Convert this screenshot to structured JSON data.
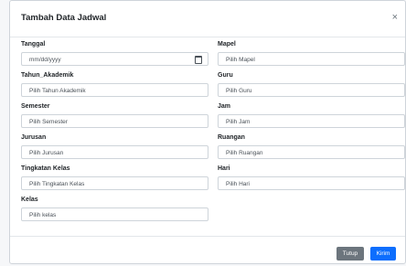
{
  "modal": {
    "title": "Tambah Data Jadwal",
    "close_glyph": "×"
  },
  "fields_left": [
    {
      "label": "Tanggal",
      "value": "mm/dd/yyyy"
    },
    {
      "label": "Tahun_Akademik",
      "value": "Pilih Tahun Akademik"
    },
    {
      "label": "Semester",
      "value": "Pilih Semester"
    },
    {
      "label": "Jurusan",
      "value": "Pilih Jurusan"
    },
    {
      "label": "Tingkatan Kelas",
      "value": "Pilih Tingkatan Kelas"
    },
    {
      "label": "Kelas",
      "value": "Pilih kelas"
    }
  ],
  "fields_right": [
    {
      "label": "Mapel",
      "value": "Pilih Mapel"
    },
    {
      "label": "Guru",
      "value": "Pilih Guru"
    },
    {
      "label": "Jam",
      "value": "Pilih Jam"
    },
    {
      "label": "Ruangan",
      "value": "Pilih Ruangan"
    },
    {
      "label": "Hari",
      "value": "Pilih Hari"
    }
  ],
  "footer": {
    "close_label": "Tutup",
    "submit_label": "Kirim"
  },
  "colors": {
    "primary": "#0d6efd",
    "secondary": "#6c757d"
  }
}
